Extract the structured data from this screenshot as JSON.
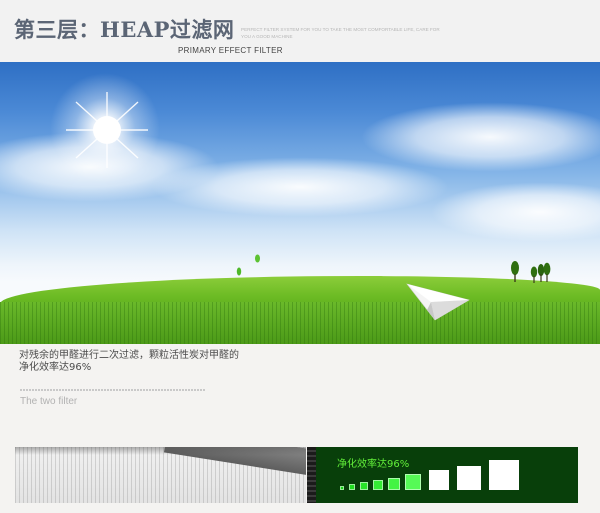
{
  "header": {
    "title": "第三层：HEAP过滤网",
    "tagline": "PERFECT FILTER SYSTEM FOR YOU TO TAKE THE MOST COMFORTABLE LIFE, CARE FOR YOU A GOOD MACHINE",
    "subtitle": "PRIMARY EFFECT FILTER"
  },
  "description": {
    "line1": "对残余的甲醛进行二次过滤，颗粒活性炭对甲醛的",
    "line2": "净化效率达96%",
    "filter_label": "The two filter"
  },
  "efficiency_panel": {
    "title": "净化效率达96%",
    "squares": [
      {
        "color": "#18d418"
      },
      {
        "color": "#20dc20"
      },
      {
        "color": "#28e428"
      },
      {
        "color": "#34ec34"
      },
      {
        "color": "#44f444"
      },
      {
        "color": "#56fa56"
      },
      {
        "color": "#ffffff"
      },
      {
        "color": "#ffffff"
      },
      {
        "color": "#ffffff"
      }
    ]
  },
  "colors": {
    "title_text": "#5b6575",
    "panel_bg": "#083f0a",
    "panel_text": "#62f03a",
    "grass": "#5aa91e"
  }
}
